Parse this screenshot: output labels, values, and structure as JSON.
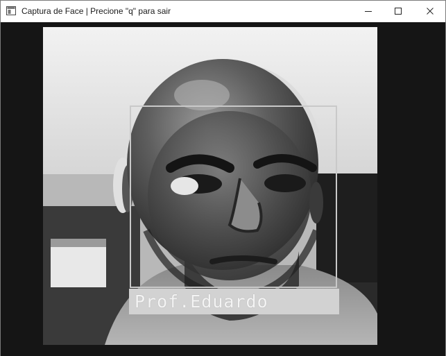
{
  "window": {
    "title": "Captura de Face | Precione \"q\" para sair"
  },
  "detection": {
    "label": "Prof.Eduardo"
  }
}
